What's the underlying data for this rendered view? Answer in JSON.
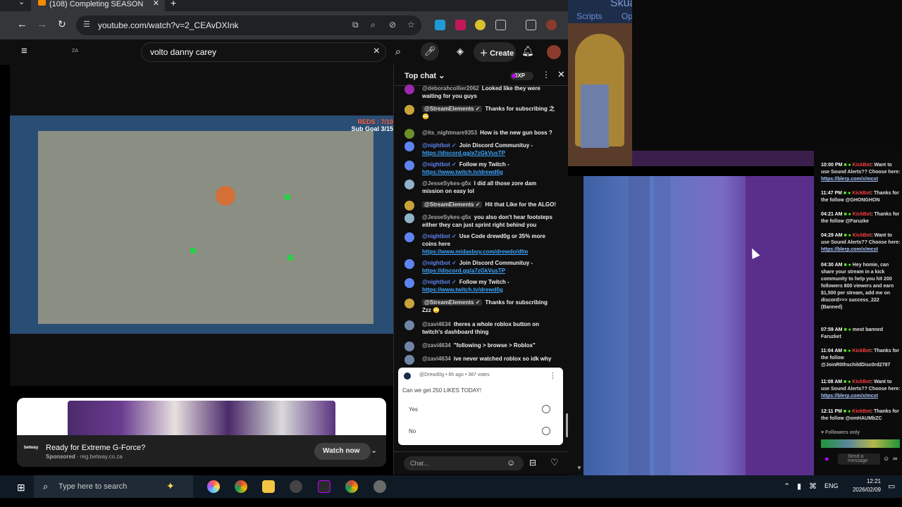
{
  "browser": {
    "tab_title": "(108) Completing SEASON",
    "url": "youtube.com/watch?v=2_CEAvDXInk",
    "tab_close": "✕",
    "new_tab": "+"
  },
  "youtube": {
    "logo_text": "ZA",
    "search_query": "volto danny carey",
    "create_label": "Create",
    "video": {
      "reds_text": "REDS : 7/10",
      "subgoal_text": "Sub Goal 3/15"
    },
    "ad": {
      "title": "Ready for Extreme G-Force?",
      "sponsored": "Sponsored",
      "domain": "reg.betway.co.za",
      "cta": "Watch now",
      "logo": "betway"
    }
  },
  "chat": {
    "header": "Top chat",
    "xp_label": "0XP",
    "messages": [
      {
        "author": "@deborahcollier2062",
        "text": "Looked like they were waiting for you guys",
        "color": "#9c27b0",
        "style": "normal"
      },
      {
        "author": "@StreamElements ✓",
        "text": "Thanks for subscribing 之 🙄",
        "color": "#c9a33a",
        "style": "badge"
      },
      {
        "author": "@its_nightmare9353",
        "text": "How is the new gun boss ?",
        "color": "#6c8f2a",
        "style": "normal"
      },
      {
        "author": "@nightbot ✓",
        "text": "Join Discord Communituy - ",
        "link": "https://discord.gg/a7zGkVusTP",
        "color": "#5e84f1",
        "style": "mod"
      },
      {
        "author": "@nightbot ✓",
        "text": "Follow my Twitch - ",
        "link": "https://www.twitch.tv/drewd0g",
        "color": "#5e84f1",
        "style": "mod"
      },
      {
        "author": "@JesseSykes-g5x",
        "text": "I did all those zore dam mission on easy lol",
        "color": "#8fb3c9",
        "style": "normal"
      },
      {
        "author": "@StreamElements ✓",
        "text": "Hit that Like for the ALGO!",
        "color": "#c9a33a",
        "style": "badge"
      },
      {
        "author": "@JesseSykes-g5x",
        "text": "you also don't hear footsteps either they can just sprint right behind you",
        "color": "#8fb3c9",
        "style": "normal"
      },
      {
        "author": "@nightbot ✓",
        "text": "Use Code drewd0g or 35% more coins here ",
        "link": "https://www.midasbuy.com/drewdo/dfm",
        "color": "#5e84f1",
        "style": "mod"
      },
      {
        "author": "@nightbot ✓",
        "text": "Join Discord Communituy - ",
        "link": "https://discord.gg/a7zGkVusTP",
        "color": "#5e84f1",
        "style": "mod"
      },
      {
        "author": "@nightbot ✓",
        "text": "Follow my Twitch - ",
        "link": "https://www.twitch.tv/drewd0g",
        "color": "#5e84f1",
        "style": "mod"
      },
      {
        "author": "@StreamElements ✓",
        "text": "Thanks for subscribing Zzz 🙄",
        "color": "#c9a33a",
        "style": "badge"
      },
      {
        "author": "@zavi4634",
        "text": "theres a whole roblox button on twitch's dashboard thing",
        "color": "#6f86a8",
        "style": "normal"
      },
      {
        "author": "@zavi4634",
        "text": "\"following > browse > Roblox\"",
        "color": "#6f86a8",
        "style": "normal"
      },
      {
        "author": "@zavi4634",
        "text": "ive never watched roblox so idk why",
        "color": "#6f86a8",
        "style": "normal"
      }
    ],
    "poll": {
      "meta": "@Drewd0g • 6h ago • 387 votes",
      "question": "Can we get 250 LIKES TODAY!",
      "options": [
        "Yes",
        "No"
      ]
    },
    "input_placeholder": "Chat..."
  },
  "skua": {
    "title": "Skua -",
    "menu_scripts": "Scripts",
    "menu_op": "Op"
  },
  "kick": {
    "messages": [
      {
        "time": "10:00 PM",
        "user": "KickBot",
        "text": "Want to use Sound Alerts?? Choose here: ",
        "link": "https://blerp.com/x/mcst"
      },
      {
        "time": "11:47 PM",
        "user": "KickBot",
        "text": "Thanks for the follow @GHONGHON"
      },
      {
        "time": "04:21 AM",
        "user": "KickBot",
        "text": "Thanks for the follow @Faruzke"
      },
      {
        "time": "04:29 AM",
        "user": "KickBot",
        "text": "Want to use Sound Alerts?? Choose here: ",
        "link": "https://blerp.com/x/mcst"
      },
      {
        "time": "04:30 AM",
        "user": "",
        "text": "Hey homie, can share your stream in a kick community to help you hit 200 followers 800 viewers and earn $1,500 per stream, add me on discord>>> success_222 (Banned)"
      },
      {
        "time": "07:59 AM",
        "user": "",
        "text": "mest banned Faruzket"
      },
      {
        "time": "11:04 AM",
        "user": "KickBot",
        "text": "Thanks for the follow @JoinR0thschildDisc0rd2787"
      },
      {
        "time": "11:08 AM",
        "user": "KickBot",
        "text": "Want to use Sound Alerts?? Choose here: ",
        "link": "https://blerp.com/x/mcst"
      },
      {
        "time": "12:11 PM",
        "user": "KickBot",
        "text": "Thanks for the follow @omHAUMbZC"
      }
    ],
    "followers_only": "Followers only",
    "send_label": "Send a message"
  },
  "taskbar": {
    "search_placeholder": "Type here to search",
    "lang": "ENG",
    "time": "12:21",
    "date": "2026/02/09"
  }
}
